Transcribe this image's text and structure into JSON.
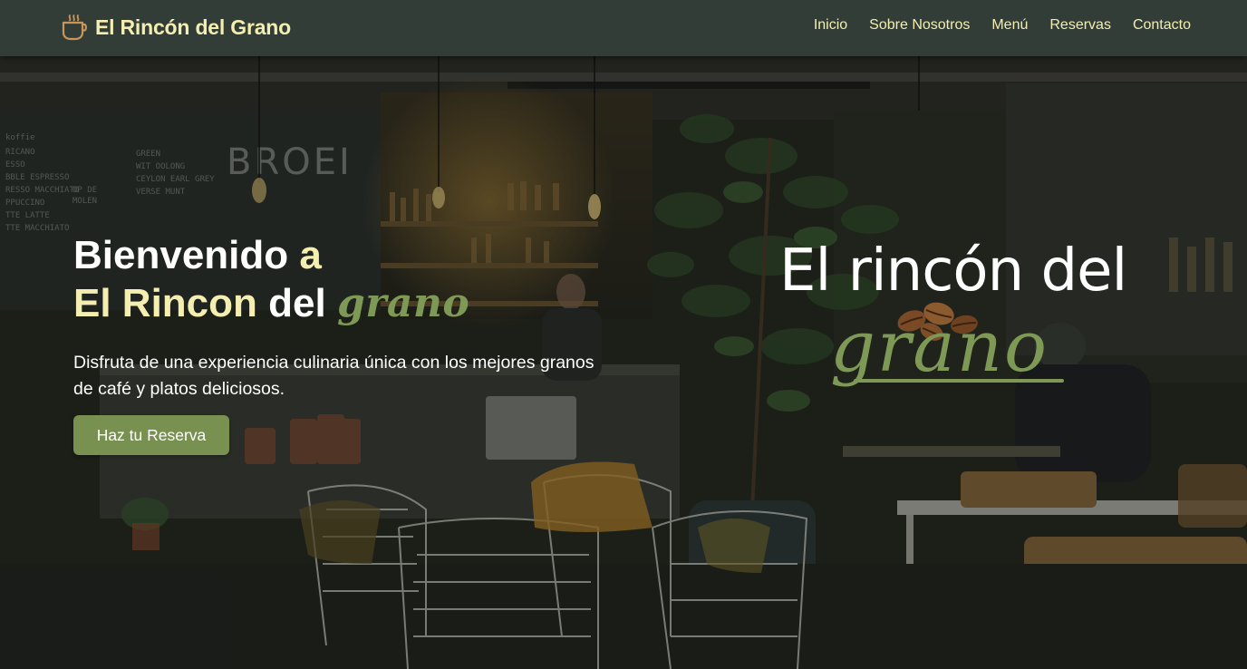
{
  "brand": {
    "name": "El Rincón del Grano",
    "icon": "coffee-cup-icon",
    "color": "#f4eeb0"
  },
  "nav": {
    "items": [
      {
        "label": "Inicio"
      },
      {
        "label": "Sobre Nosotros"
      },
      {
        "label": "Menú"
      },
      {
        "label": "Reservas"
      },
      {
        "label": "Contacto"
      }
    ]
  },
  "hero": {
    "title_line1_white": "Bienvenido",
    "title_line1_accent": "a",
    "title_line2_accent": "El Rincon",
    "title_line2_white": "del",
    "title_line2_script": "grano",
    "subtitle": "Disfruta de una experiencia culinaria única con los mejores granos de café y platos deliciosos.",
    "cta_label": "Haz tu Reserva",
    "logo_line1": "El rincón del",
    "logo_line2": "grano",
    "background": "coffee-shop-interior-photo"
  },
  "colors": {
    "navbar": "#323d37",
    "accent_yellow": "#f4eeb0",
    "accent_green": "#7d9955",
    "button": "#789050"
  }
}
